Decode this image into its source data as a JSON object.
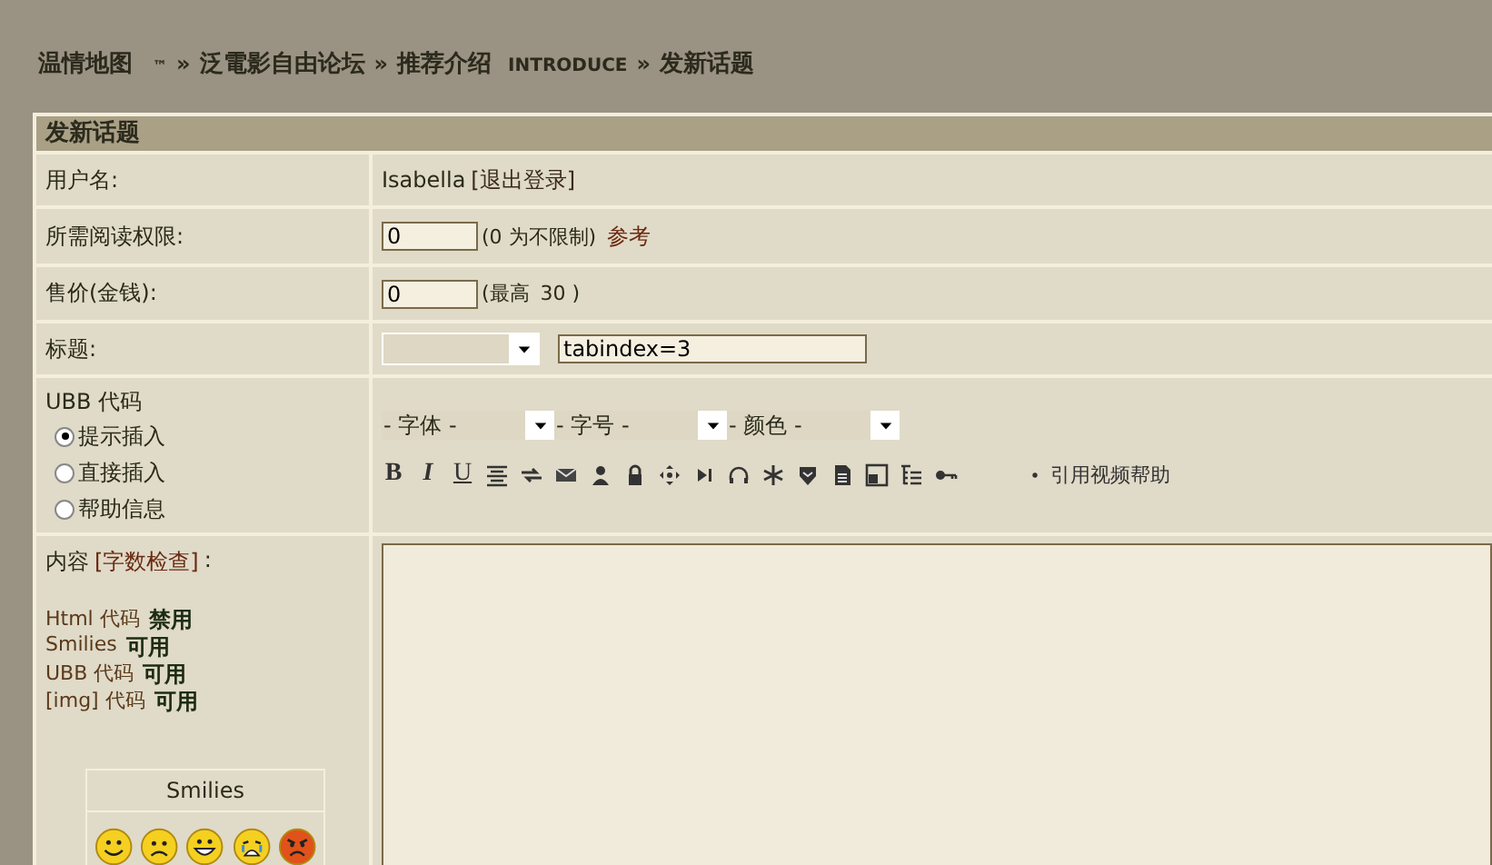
{
  "breadcrumb": [
    {
      "text": "温情地图",
      "sup": "™"
    },
    {
      "separator": "»",
      "text": "泛電影自由论坛"
    },
    {
      "separator": "»",
      "text": "推荐介绍",
      "small": "INTRODUCE"
    },
    {
      "separator": "»",
      "text": "发新话题"
    }
  ],
  "panel_title": "发新话题",
  "user_row": {
    "label": "用户名:",
    "username": "Isabella",
    "logout": "[退出登录]"
  },
  "permission_row": {
    "label": "所需阅读权限:",
    "value": "0",
    "hint": "(0 为不限制)",
    "link": "参考"
  },
  "price_row": {
    "label": "售价(金钱):",
    "value": "0",
    "hint": "(最高",
    "max": "30 )"
  },
  "subject_row": {
    "label": "标题:",
    "subject": "tabindex=3"
  },
  "ubb_row": {
    "label": "UBB 代码",
    "modes": [
      {
        "label": "提示插入",
        "selected": true
      },
      {
        "label": "直接插入",
        "selected": false
      },
      {
        "label": "帮助信息",
        "selected": false
      }
    ],
    "selects": [
      "- 字体 -",
      "- 字号 -",
      "- 颜色 -"
    ],
    "tools": [
      {
        "kind": "bold",
        "label": "B"
      },
      {
        "kind": "italic",
        "label": "I"
      },
      {
        "kind": "underline",
        "label": "U"
      },
      {
        "kind": "align"
      },
      {
        "kind": "swap"
      },
      {
        "kind": "mail"
      },
      {
        "kind": "person"
      },
      {
        "kind": "lock"
      },
      {
        "kind": "move"
      },
      {
        "kind": "play"
      },
      {
        "kind": "headphones"
      },
      {
        "kind": "star"
      },
      {
        "kind": "shield"
      },
      {
        "kind": "document"
      },
      {
        "kind": "image"
      },
      {
        "kind": "list"
      },
      {
        "kind": "key"
      }
    ],
    "video_help": "引用视频帮助"
  },
  "content_row": {
    "label": "内容",
    "check_link": "[字数检查]",
    "colon": ":",
    "flags": [
      {
        "name": "Html 代码",
        "value": "禁用"
      },
      {
        "name": "Smilies",
        "value": "可用"
      },
      {
        "name": "UBB 代码",
        "value": "可用"
      },
      {
        "name": "[img] 代码",
        "value": "可用"
      }
    ],
    "smilies_title": "Smilies",
    "smilies": [
      {
        "kind": "happy"
      },
      {
        "kind": "sad"
      },
      {
        "kind": "grin"
      },
      {
        "kind": "cry"
      },
      {
        "kind": "angry"
      }
    ]
  }
}
